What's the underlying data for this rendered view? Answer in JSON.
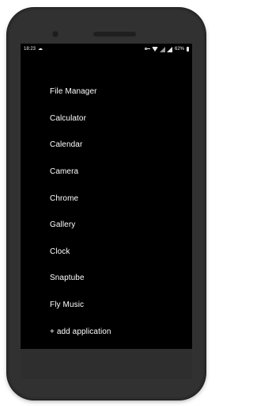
{
  "status_bar": {
    "time": "18:23",
    "battery": "62%",
    "icons": [
      "cast-icon",
      "key-icon",
      "wifi-icon",
      "signal-icon",
      "signal-icon",
      "battery-icon"
    ]
  },
  "app_list": [
    {
      "label": "File Manager"
    },
    {
      "label": "Calculator"
    },
    {
      "label": "Calendar"
    },
    {
      "label": "Camera"
    },
    {
      "label": "Chrome"
    },
    {
      "label": "Gallery"
    },
    {
      "label": "Clock"
    },
    {
      "label": "Snaptube"
    },
    {
      "label": "Fly Music"
    }
  ],
  "add_application": "+ add application",
  "colors": {
    "screen_bg": "#000000",
    "text": "#ffffff",
    "phone_body": "#2c2c2c"
  }
}
